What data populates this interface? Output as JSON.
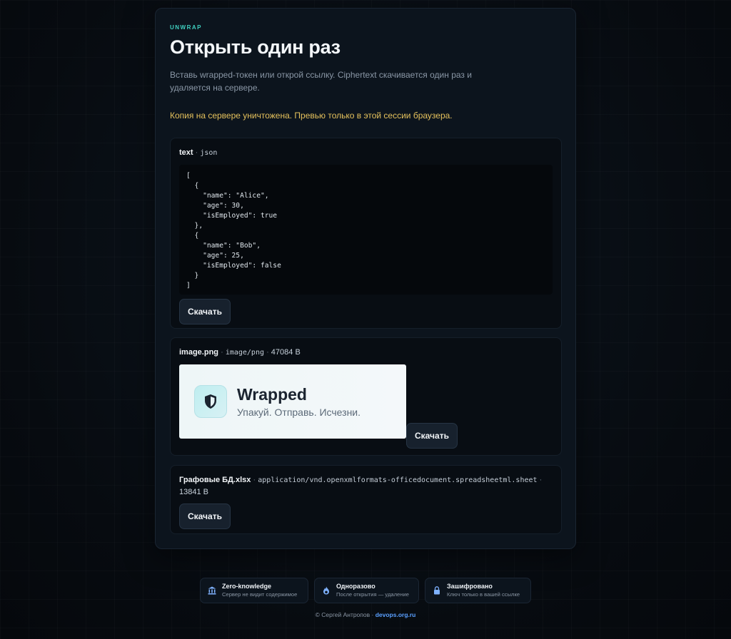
{
  "header": {
    "eyebrow": "UNWRAP",
    "title": "Открыть один раз",
    "subtitle": "Вставь wrapped-токен или открой ссылку. Ciphertext скачивается один раз и удаляется на сервере."
  },
  "warning": "Копия на сервере уничтожена. Превью только в этой сессии браузера.",
  "items": [
    {
      "name": "text",
      "type": "json",
      "content": "[\n  {\n    \"name\": \"Alice\",\n    \"age\": 30,\n    \"isEmployed\": true\n  },\n  {\n    \"name\": \"Bob\",\n    \"age\": 25,\n    \"isEmployed\": false\n  }\n]",
      "download_label": "Скачать"
    },
    {
      "name": "image.png",
      "type": "image/png",
      "size": "47084 B",
      "preview": {
        "wordmark": "Wrapped",
        "tagline": "Упакуй. Отправь. Исчезни.",
        "icon": "shield-icon"
      },
      "download_label": "Скачать"
    },
    {
      "name": "Графовые БД.xlsx",
      "type": "application/vnd.openxmlformats-officedocument.spreadsheetml.sheet",
      "size": "13841 B",
      "download_label": "Скачать"
    }
  ],
  "separator": "·",
  "badges": [
    {
      "title": "Zero-knowledge",
      "subtitle": "Сервер не видит содержимое",
      "icon": "bank-icon"
    },
    {
      "title": "Одноразово",
      "subtitle": "После открытия — удаление",
      "icon": "fire-icon"
    },
    {
      "title": "Зашифровано",
      "subtitle": "Ключ только в вашей ссылке",
      "icon": "lock-icon"
    }
  ],
  "footer": {
    "copyright": "© Сергей Антропов ·",
    "link": "devops.org.ru"
  },
  "colors": {
    "accent": "#3fd0c0",
    "warning": "#e5c15c",
    "link": "#5aa0ff",
    "card_bg": "#0c141d"
  }
}
